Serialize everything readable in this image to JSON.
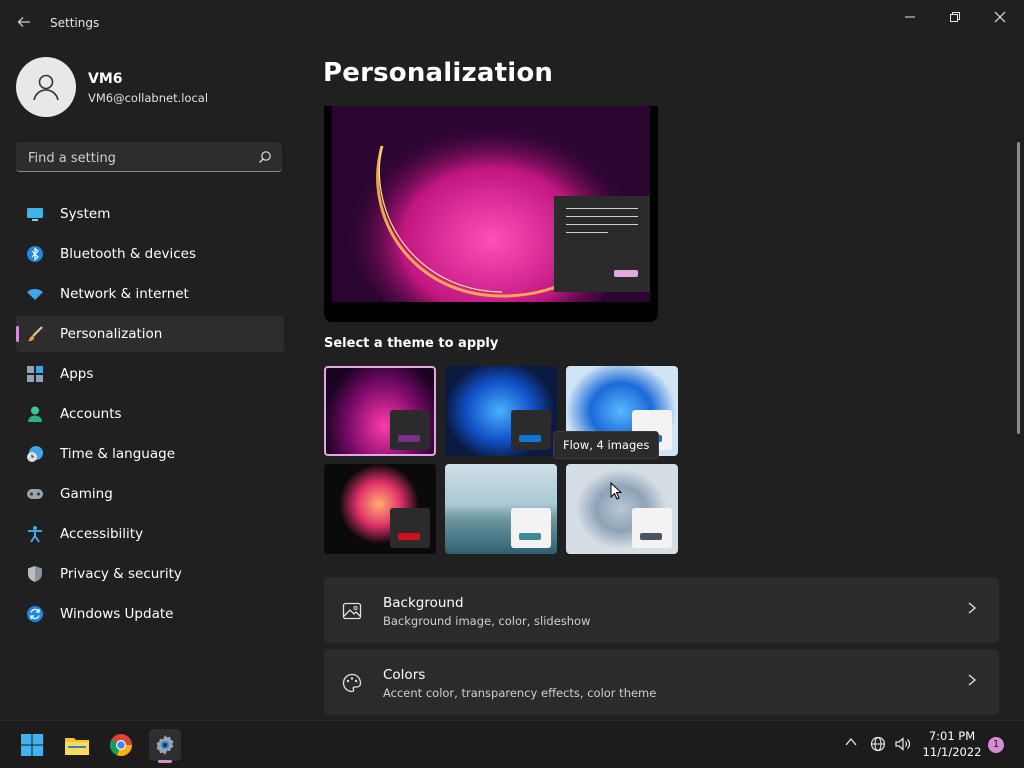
{
  "window": {
    "title": "Settings",
    "back_icon": "back-arrow-icon",
    "controls": [
      "minimize-icon",
      "restore-icon",
      "close-icon"
    ]
  },
  "user": {
    "name": "VM6",
    "email": "VM6@collabnet.local"
  },
  "search": {
    "placeholder": "Find a setting"
  },
  "nav": {
    "items": [
      {
        "label": "System",
        "icon": "system-icon"
      },
      {
        "label": "Bluetooth & devices",
        "icon": "bluetooth-icon"
      },
      {
        "label": "Network & internet",
        "icon": "wifi-icon"
      },
      {
        "label": "Personalization",
        "icon": "brush-icon",
        "selected": true
      },
      {
        "label": "Apps",
        "icon": "apps-icon"
      },
      {
        "label": "Accounts",
        "icon": "person-icon"
      },
      {
        "label": "Time & language",
        "icon": "clock-globe-icon"
      },
      {
        "label": "Gaming",
        "icon": "gamepad-icon"
      },
      {
        "label": "Accessibility",
        "icon": "accessibility-icon"
      },
      {
        "label": "Privacy & security",
        "icon": "shield-icon"
      },
      {
        "label": "Windows Update",
        "icon": "update-icon"
      }
    ]
  },
  "main": {
    "title": "Personalization",
    "themes_header": "Select a theme to apply",
    "tooltip": "Flow, 4 images",
    "themes": [
      {
        "accent": "#7a2f8a",
        "selected": true
      },
      {
        "accent": "#0a78d4"
      },
      {
        "accent": "#0a78d4"
      },
      {
        "accent": "#d00f1f"
      },
      {
        "accent": "#3a8c9a"
      },
      {
        "accent": "#4a5562"
      }
    ],
    "cards": [
      {
        "title": "Background",
        "subtitle": "Background image, color, slideshow",
        "icon": "image-icon"
      },
      {
        "title": "Colors",
        "subtitle": "Accent color, transparency effects, color theme",
        "icon": "palette-icon"
      }
    ]
  },
  "taskbar": {
    "apps": [
      "windows-start-icon",
      "file-explorer-icon",
      "chrome-icon",
      "settings-icon"
    ],
    "tray": [
      "chevron-up-icon",
      "globe-icon",
      "speaker-icon"
    ],
    "time": "7:01 PM",
    "date": "11/1/2022",
    "notification_count": "1"
  },
  "colors": {
    "accent": "#d88cd4",
    "background": "#202020",
    "card": "#2b2b2b"
  }
}
